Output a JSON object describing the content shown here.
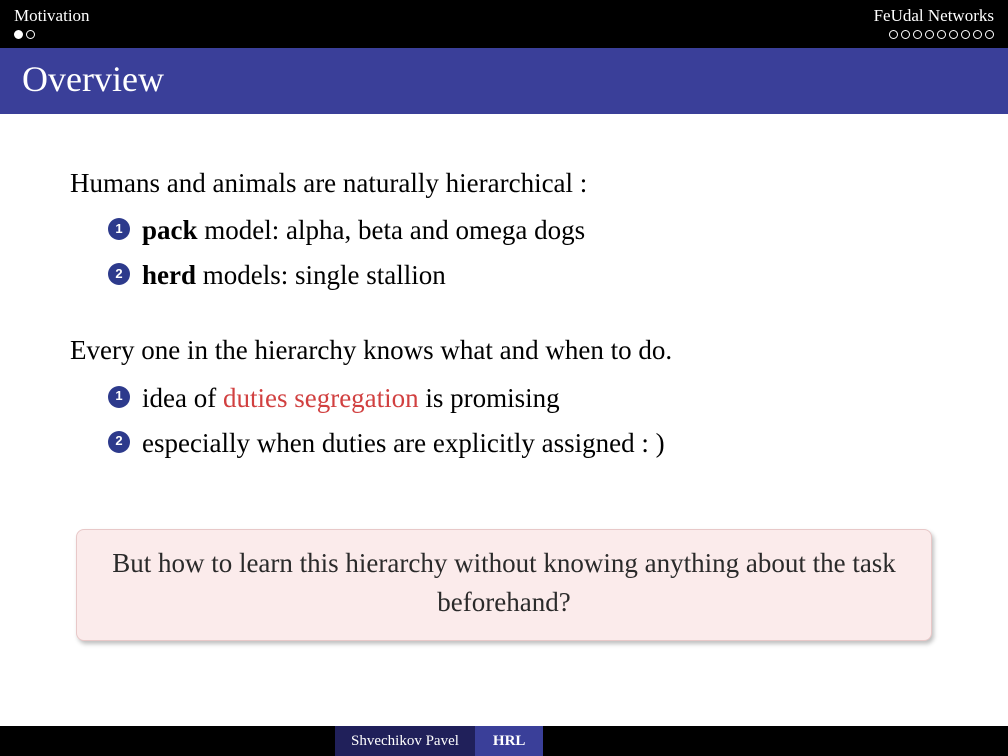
{
  "header": {
    "section_left_label": "Motivation",
    "section_right_label": "FeUdal Networks",
    "left_slide_count": 2,
    "left_current_slide": 1,
    "right_slide_count": 9,
    "right_current_slide": 0
  },
  "title": "Overview",
  "body": {
    "para1": "Humans and animals are naturally hierarchical :",
    "list1": [
      {
        "bold": "pack",
        "rest": " model: alpha, beta and omega dogs"
      },
      {
        "bold": "herd",
        "rest": " models: single stallion"
      }
    ],
    "para2": "Every one in the hierarchy knows what and when to do.",
    "list2": [
      {
        "pre": "idea of ",
        "red": "duties segregation",
        "post": " is promising"
      },
      {
        "pre": "especially when duties are explicitly assigned : )",
        "red": "",
        "post": ""
      }
    ],
    "question": "But how to learn this hierarchy without knowing anything about the task beforehand?"
  },
  "footer": {
    "author": "Shvechikov Pavel",
    "short_title": "HRL"
  }
}
